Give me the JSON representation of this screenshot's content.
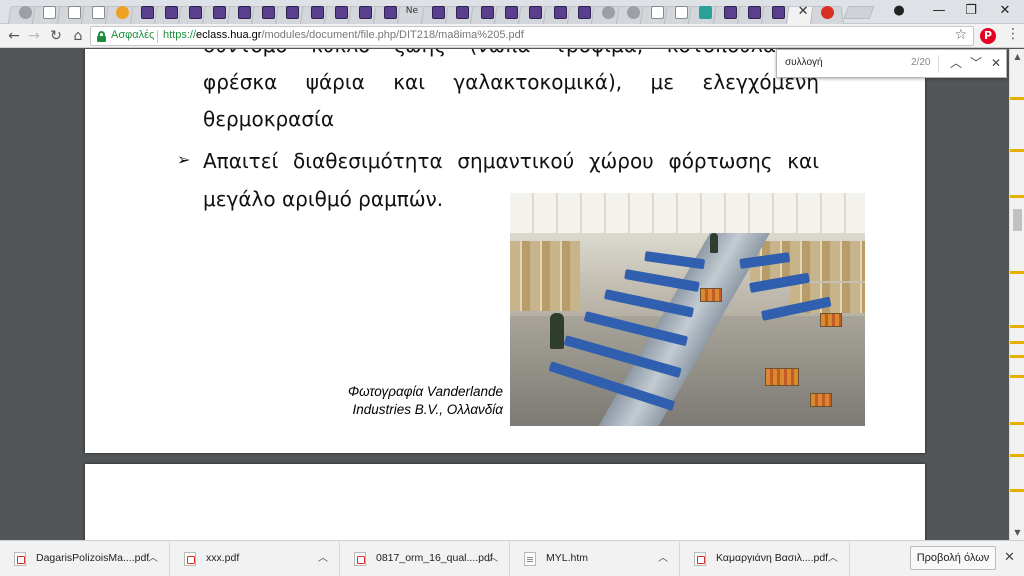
{
  "browser": {
    "tabs": [
      {
        "icon": "back-icon"
      },
      {
        "icon": "doc-icon"
      },
      {
        "icon": "doc-icon"
      },
      {
        "icon": "doc-icon"
      },
      {
        "icon": "orange-circle-icon"
      },
      {
        "icon": "eclass-icon"
      },
      {
        "icon": "eclass-icon"
      },
      {
        "icon": "eclass-icon"
      },
      {
        "icon": "eclass-icon"
      },
      {
        "icon": "eclass-icon"
      },
      {
        "icon": "eclass-icon"
      },
      {
        "icon": "eclass-icon"
      },
      {
        "icon": "eclass-icon"
      },
      {
        "icon": "eclass-icon"
      },
      {
        "icon": "eclass-icon"
      },
      {
        "icon": "eclass-icon"
      },
      {
        "icon": "news-icon",
        "label": "Ne"
      },
      {
        "icon": "eclass-icon"
      },
      {
        "icon": "eclass-icon"
      },
      {
        "icon": "eclass-icon"
      },
      {
        "icon": "eclass-icon"
      },
      {
        "icon": "eclass-icon"
      },
      {
        "icon": "eclass-icon"
      },
      {
        "icon": "eclass-icon"
      },
      {
        "icon": "shield-icon"
      },
      {
        "icon": "sync-icon"
      },
      {
        "icon": "pen-icon"
      },
      {
        "icon": "doc-icon"
      },
      {
        "icon": "green-app-icon"
      },
      {
        "icon": "eclass-icon"
      },
      {
        "icon": "eclass-icon"
      },
      {
        "icon": "eclass-icon"
      },
      {
        "icon": "close-icon",
        "active": true
      },
      {
        "icon": "red-circle-icon"
      }
    ],
    "security_label": "Ασφαλές",
    "url_scheme": "https://",
    "url_host": "eclass.hua.gr",
    "url_path": "/modules/document/file.php/DIT218/ma8ima%205.pdf"
  },
  "find": {
    "query": "συλλογή",
    "count": "2/20"
  },
  "slide": {
    "line1": "σύντομο κύκλο ζωής (νωπά τρόφιμα, κοτόπουλα, α",
    "line2": "φρέσκα ψάρια και γαλακτοκομικά), με ελεγχόμενη",
    "line3": "θερμοκρασία",
    "bullet_glyph": "➢",
    "line4": "Απαιτεί διαθεσιμότητα σημαντικού χώρου φόρτωσης και",
    "line5": "μεγάλο αριθμό ραμπών.",
    "caption_line1": "Φωτογραφία Vanderlande",
    "caption_line2": "Industries B.V., Ολλανδία"
  },
  "downloads": {
    "items": [
      {
        "name": "DagarisPolizoisMa....pdf",
        "type": "pdf"
      },
      {
        "name": "xxx.pdf",
        "type": "pdf"
      },
      {
        "name": "0817_orm_16_qual....pdf",
        "type": "pdf"
      },
      {
        "name": "MYL.htm",
        "type": "htm"
      },
      {
        "name": "Καμαργιάνη Βασιλ....pdf",
        "type": "pdf"
      }
    ],
    "show_all_label": "Προβολή όλων"
  }
}
